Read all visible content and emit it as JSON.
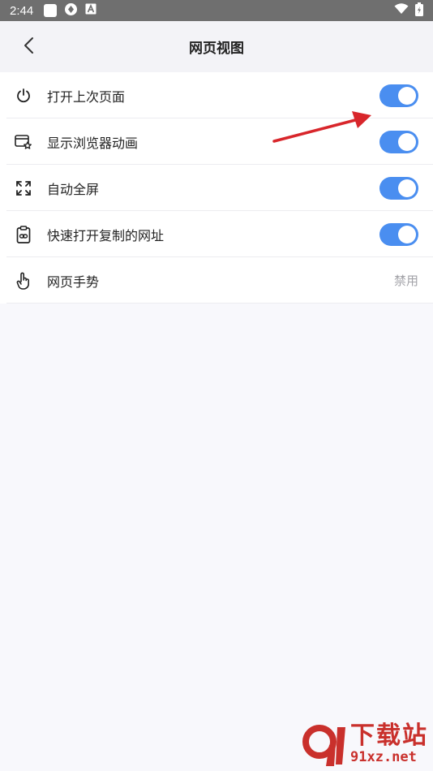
{
  "status_bar": {
    "time": "2:44",
    "icons": [
      "notification-square-icon",
      "sync-icon",
      "a-badge-icon",
      "wifi-icon",
      "battery-icon"
    ]
  },
  "header": {
    "title": "网页视图",
    "back_icon": "back-chevron-icon"
  },
  "settings": [
    {
      "icon": "power-icon",
      "label": "打开上次页面",
      "toggle_on": true
    },
    {
      "icon": "browser-star-icon",
      "label": "显示浏览器动画",
      "toggle_on": true
    },
    {
      "icon": "fullscreen-icon",
      "label": "自动全屏",
      "toggle_on": true
    },
    {
      "icon": "clipboard-link-icon",
      "label": "快速打开复制的网址",
      "toggle_on": true
    },
    {
      "icon": "hand-gesture-icon",
      "label": "网页手势",
      "value": "禁用"
    }
  ],
  "colors": {
    "accent": "#4a8ef0",
    "annotation_arrow": "#d8262b"
  },
  "watermark": {
    "line1": "下载站",
    "line2": "91xz.net"
  }
}
